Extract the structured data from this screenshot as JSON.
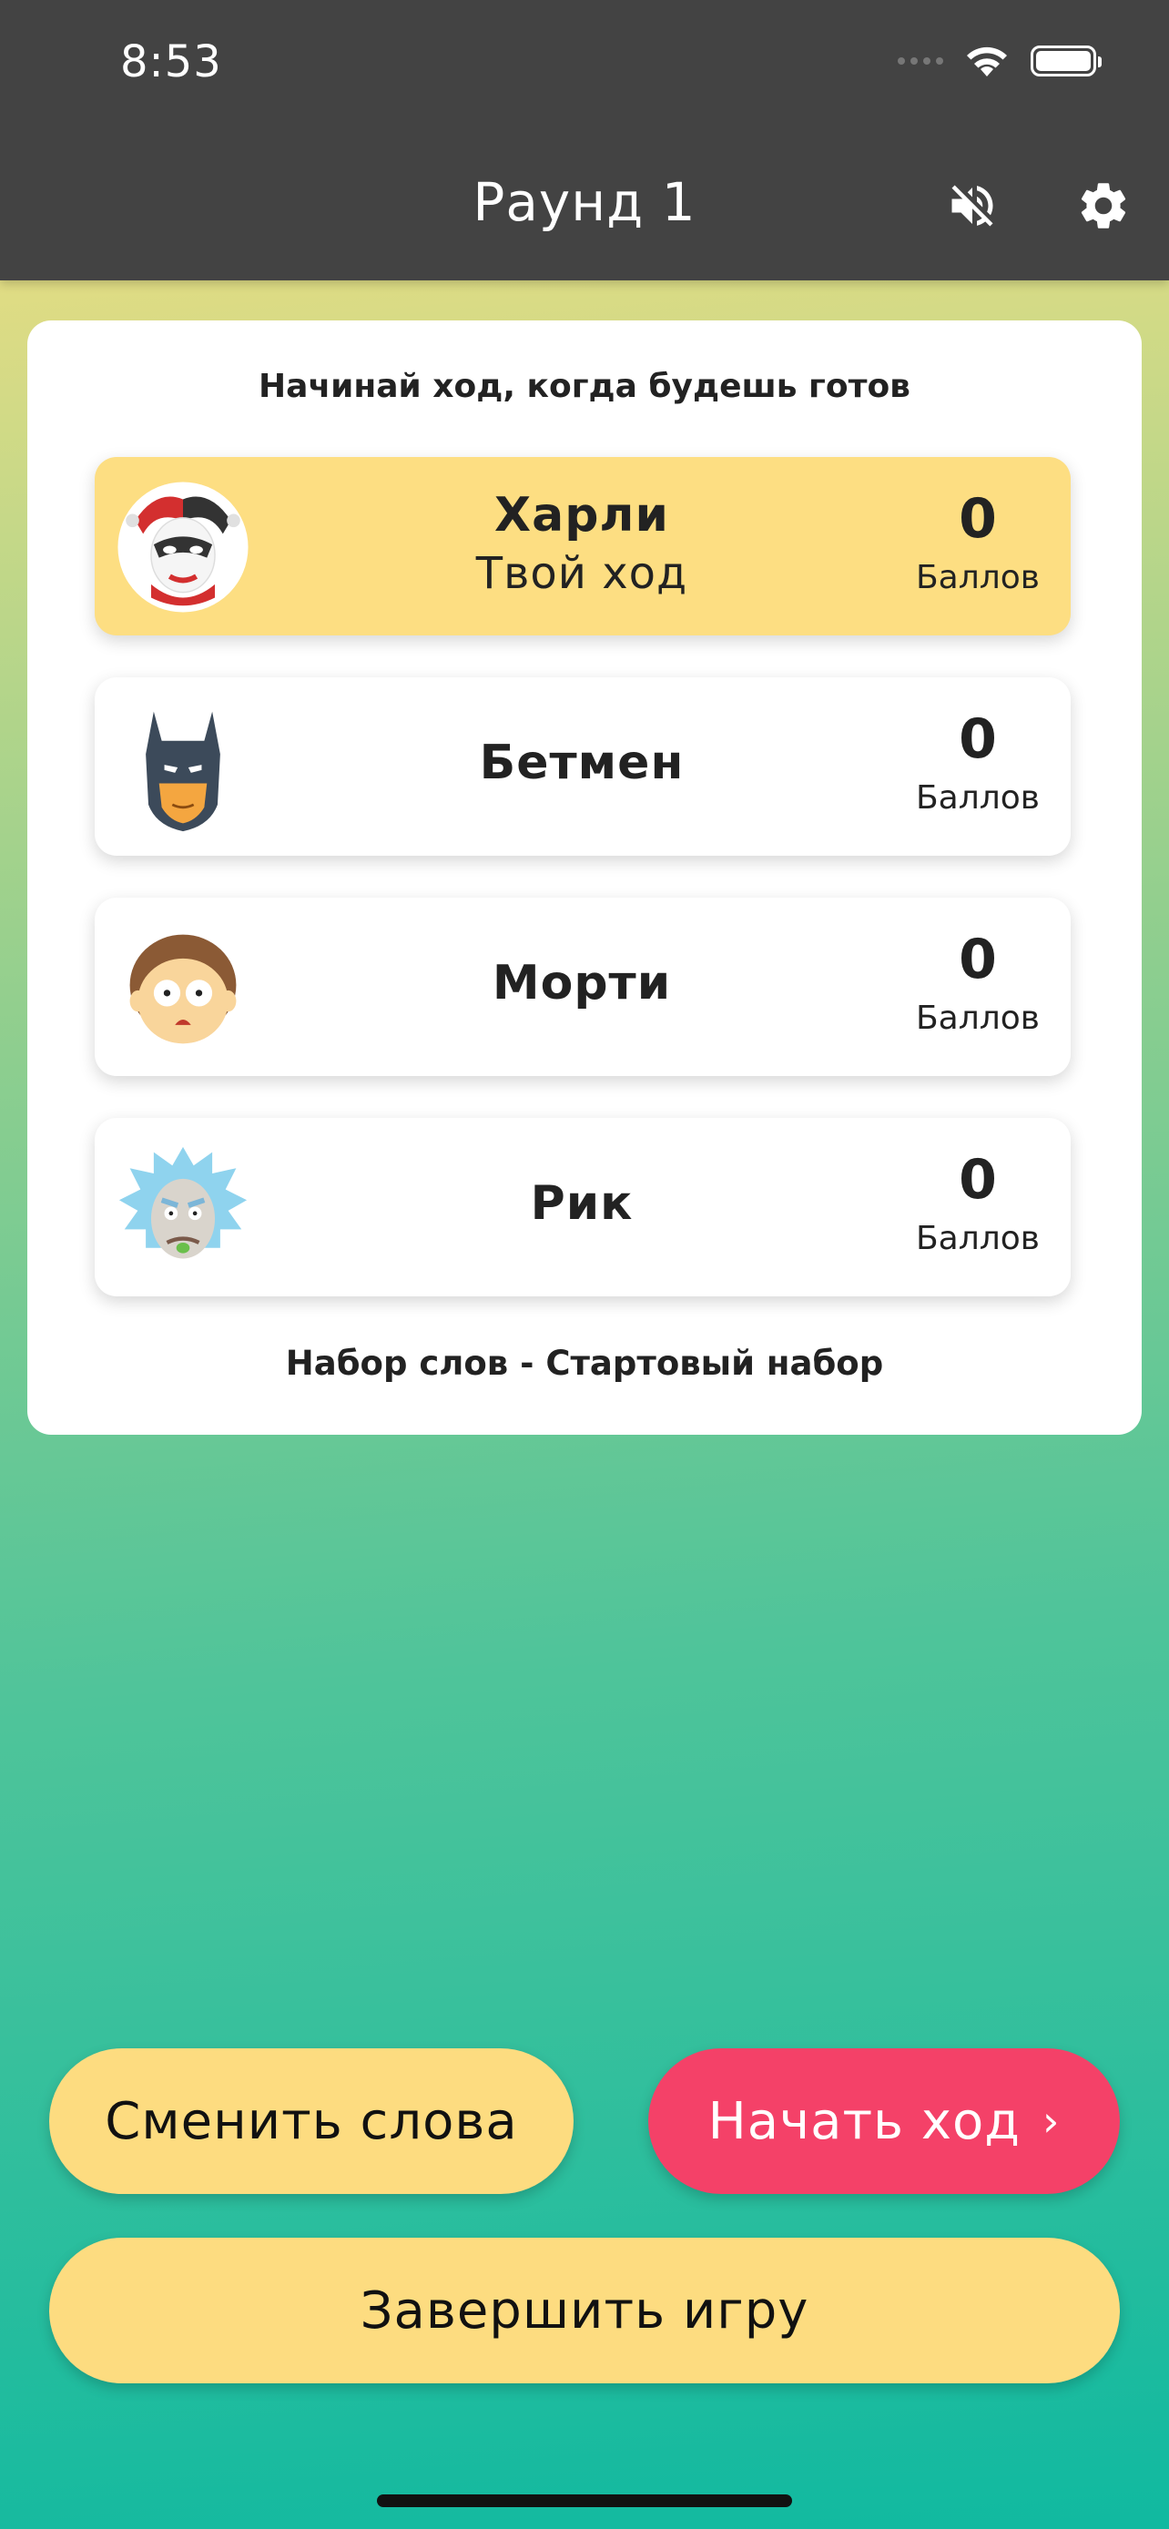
{
  "status_bar": {
    "time": "8:53"
  },
  "header": {
    "title": "Раунд 1",
    "mute_icon": "volume-off-icon",
    "settings_icon": "gear-icon"
  },
  "card": {
    "header": "Начинай ход, когда будешь готов",
    "players": [
      {
        "name": "Харли",
        "subtitle": "Твой ход",
        "score": "0",
        "score_label": "Баллов",
        "active": true,
        "avatar": "harley-quinn-avatar"
      },
      {
        "name": "Бетмен",
        "subtitle": "",
        "score": "0",
        "score_label": "Баллов",
        "active": false,
        "avatar": "batman-avatar"
      },
      {
        "name": "Морти",
        "subtitle": "",
        "score": "0",
        "score_label": "Баллов",
        "active": false,
        "avatar": "morty-avatar"
      },
      {
        "name": "Рик",
        "subtitle": "",
        "score": "0",
        "score_label": "Баллов",
        "active": false,
        "avatar": "rick-avatar"
      }
    ],
    "footer": "Набор слов - Стартовый набор"
  },
  "buttons": {
    "change_words": "Сменить слова",
    "start_turn": "Начать ход",
    "start_turn_chevron": "›",
    "end_game": "Завершить игру"
  },
  "colors": {
    "header_bg": "#434343",
    "active_player_bg": "#fdde82",
    "yellow_button": "#fddc80",
    "pink_button": "#f44168",
    "gradient_top": "#ffe07f",
    "gradient_bottom": "#10b9a0"
  }
}
